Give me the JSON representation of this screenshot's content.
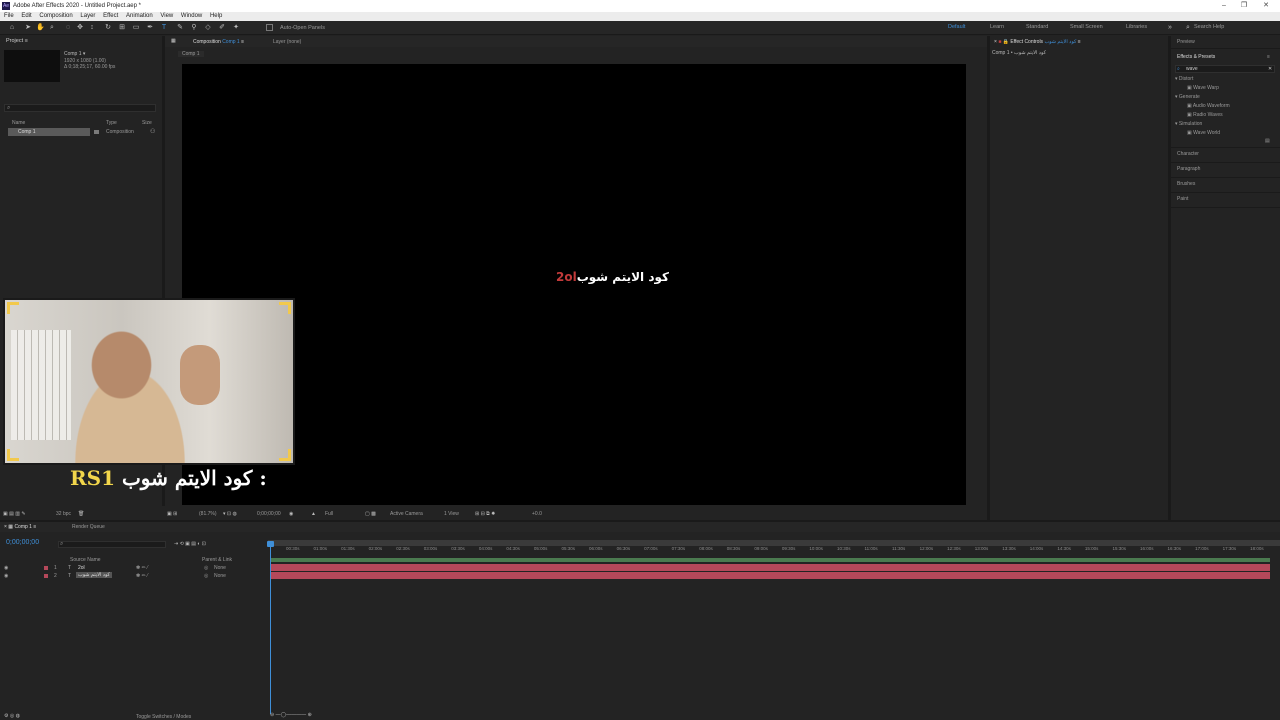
{
  "window": {
    "title": "Adobe After Effects 2020 - Untitled Project.aep *",
    "controls": [
      "–",
      "❐",
      "✕"
    ]
  },
  "menu": [
    "File",
    "Edit",
    "Composition",
    "Layer",
    "Effect",
    "Animation",
    "View",
    "Window",
    "Help"
  ],
  "toolbar": {
    "auto_open_panels": "Auto-Open Panels",
    "workspaces": [
      "Default",
      "Learn",
      "Standard",
      "Small Screen",
      "Libraries"
    ],
    "active_workspace": "Default",
    "search_help": "Search Help"
  },
  "project": {
    "tab": "Project",
    "comp_name": "Comp 1 ▾",
    "comp_info_1": "1920 x 1080 (1.00)",
    "comp_info_2": "Δ 0;18;25;17, 60.00 fps",
    "columns": [
      "Name",
      "Type",
      "Size"
    ],
    "items": [
      {
        "name": "Comp 1",
        "type": "Composition"
      }
    ]
  },
  "composition": {
    "tab_prefix": "Composition",
    "tab_name": "Comp 1",
    "layer_tab": "Layer (none)",
    "sub_tab": "Comp 1",
    "overlay_text": "كود الايتم شوب",
    "overlay_code": "2ol"
  },
  "viewer_bar": {
    "zoom": "(81.7%)",
    "time": "0;00;00;00",
    "resolution": "Full",
    "camera": "Active Camera",
    "views": "1 View",
    "exposure": "+0.0"
  },
  "effect_controls": {
    "tab": "Effect Controls",
    "layer_name": "كود الايتم شوب",
    "path": "Comp 1 • كود الايتم شوب"
  },
  "right_panels": {
    "preview": "Preview",
    "effects_presets": "Effects & Presets",
    "search_value": "wave",
    "tree": [
      {
        "category": "Distort",
        "items": [
          "Wave Warp"
        ]
      },
      {
        "category": "Generate",
        "items": [
          "Audio Waveform",
          "Radio Waves"
        ]
      },
      {
        "category": "Simulation",
        "items": [
          "Wave World"
        ]
      }
    ],
    "collapsed": [
      "Character",
      "Paragraph",
      "Brushes",
      "Paint"
    ]
  },
  "webcam": {
    "caption_text": "كود الايتم شوب :",
    "caption_code": "RS1"
  },
  "timeline": {
    "bpc": "32 bpc",
    "tabs": [
      "Comp 1",
      "Render Queue"
    ],
    "current_time": "0;00;00;00",
    "columns": [
      "Source Name",
      "Parent & Link"
    ],
    "layers": [
      {
        "num": "1",
        "name": "2ol",
        "parent": "None"
      },
      {
        "num": "2",
        "name": "كود الايتم شوب",
        "parent": "None"
      }
    ],
    "ruler": [
      "00:30s",
      "01:00s",
      "01:30s",
      "02:00s",
      "02:30s",
      "03:00s",
      "03:30s",
      "04:00s",
      "04:30s",
      "05:00s",
      "05:30s",
      "06:00s",
      "06:30s",
      "07:00s",
      "07:30s",
      "08:00s",
      "08:30s",
      "09:00s",
      "09:30s",
      "10:00s",
      "10:30s",
      "11:00s",
      "11:30s",
      "12:00s",
      "12:30s",
      "13:00s",
      "13:30s",
      "14:00s",
      "14:30s",
      "15:00s",
      "15:30s",
      "16:00s",
      "16:30s",
      "17:00s",
      "17:30s",
      "18:00s"
    ],
    "toggle_label": "Toggle Switches / Modes"
  },
  "colors": {
    "accent": "#3f8fd8",
    "layer_green": "#4a7a4f",
    "layer_red": "#b5485a",
    "caption_yellow": "#f2d64b"
  }
}
